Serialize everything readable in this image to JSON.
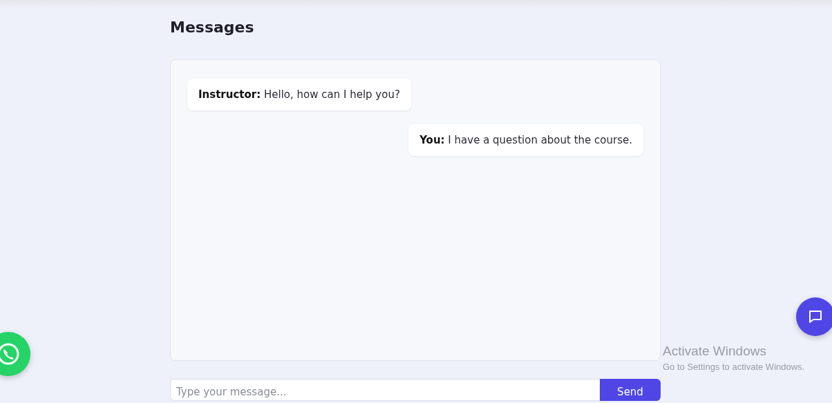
{
  "title": "Messages",
  "messages": [
    {
      "kind": "received",
      "text": "**Instructor:** Hello, how can I help you?"
    },
    {
      "kind": "sent",
      "text": "**You:** I have a question about the course."
    }
  ],
  "composer": {
    "placeholder": "Type your message...",
    "button": "Send"
  },
  "os_notice": {
    "title": "Activate Windows",
    "subtitle": "Go to Settings to activate Windows."
  }
}
